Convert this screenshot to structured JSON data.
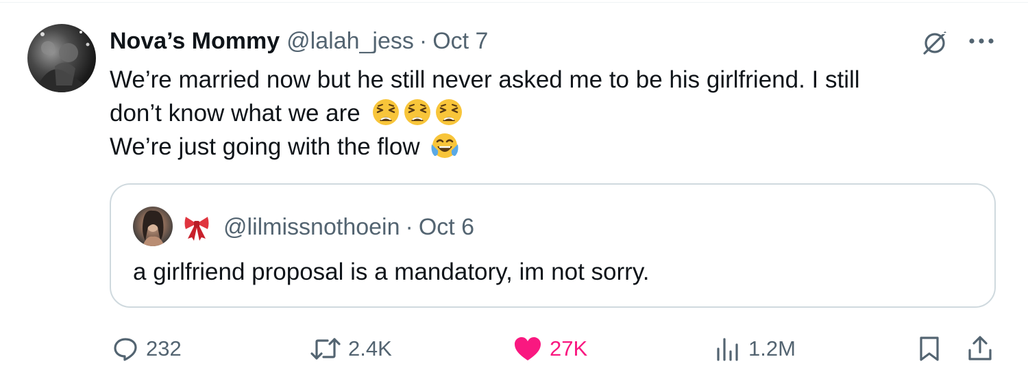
{
  "post": {
    "author": {
      "display_name": "Nova’s Mommy",
      "handle": "@lalah_jess",
      "separator": "·",
      "date": "Oct 7"
    },
    "text_lines": [
      "We’re married now but he still never asked me to be his girlfriend. I still",
      "don’t know what we are",
      "We’re just going with the flow"
    ],
    "emojis": {
      "line2": [
        "weary-face-emoji",
        "weary-face-emoji",
        "weary-face-emoji"
      ],
      "line3": [
        "face-with-tears-of-joy-emoji"
      ]
    },
    "icons": {
      "grok": "grok-icon",
      "more": "more-icon"
    }
  },
  "quote": {
    "author_emoji": "ribbon-bow-icon",
    "handle": "@lilmissnothoein",
    "separator": "·",
    "date": "Oct 6",
    "text": "a girlfriend proposal is a mandatory, im not sorry."
  },
  "actions": {
    "replies": "232",
    "reposts": "2.4K",
    "likes": "27K",
    "views": "1.2M",
    "liked": true
  },
  "colors": {
    "text": "#0f1419",
    "secondary": "#536471",
    "like": "#f91880",
    "border": "#cfd9de"
  }
}
